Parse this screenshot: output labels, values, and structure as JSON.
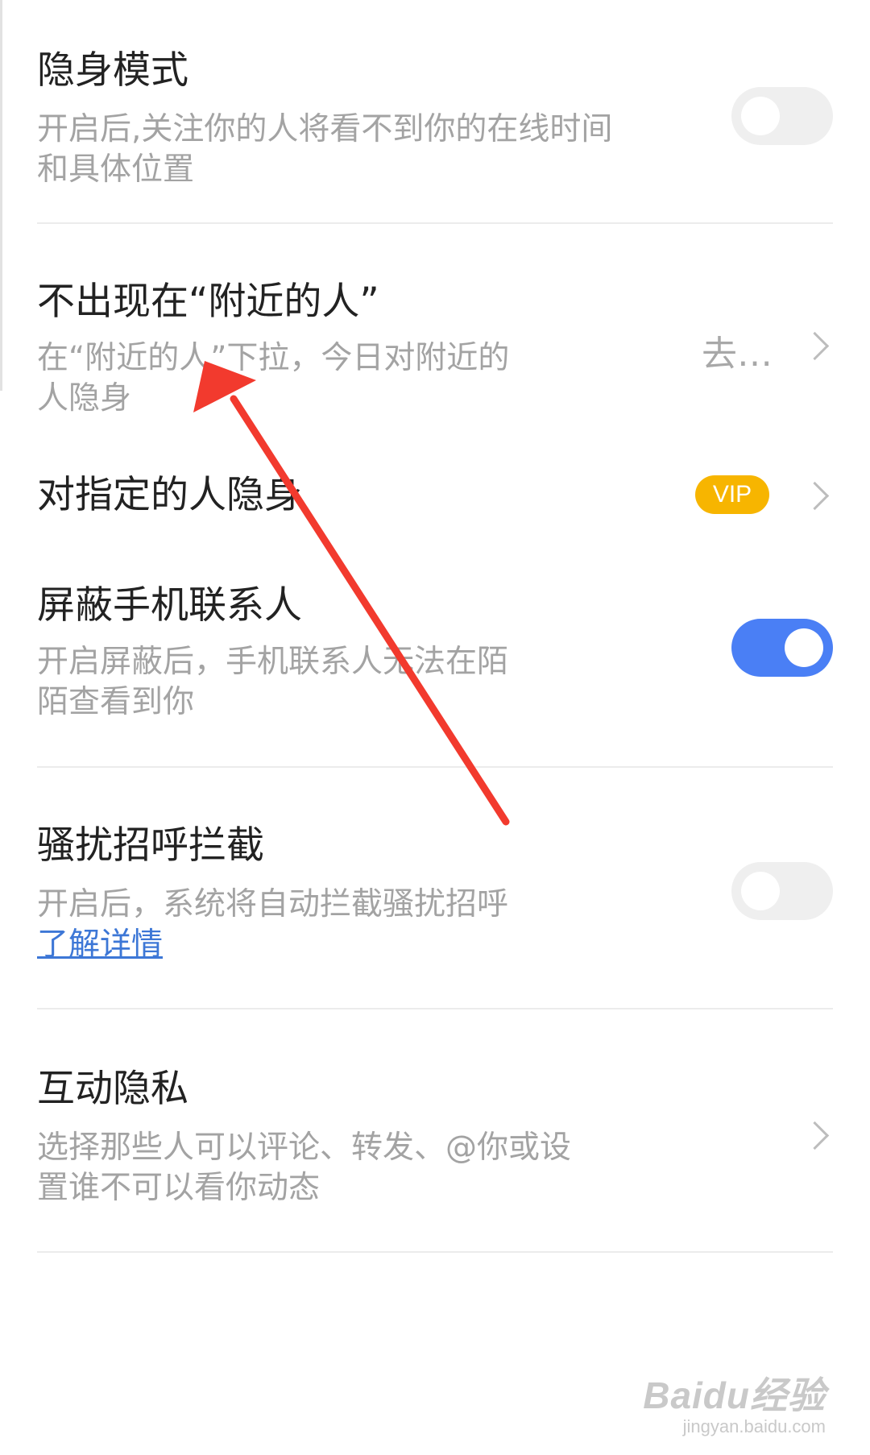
{
  "stealth_mode": {
    "title": "隐身模式",
    "description": "开启后,关注你的人将看不到你的在线时间和具体位置",
    "toggle_state": "off"
  },
  "nearby_people": {
    "title": "不出现在“附近的人”",
    "description": "在“附近的人”下拉，今日对附近的人隐身",
    "value": "去…"
  },
  "hide_from_specific": {
    "title": "对指定的人隐身",
    "badge": "VIP"
  },
  "block_contacts": {
    "title": "屏蔽手机联系人",
    "description": "开启屏蔽后，手机联系人无法在陌陌查看到你",
    "toggle_state": "on"
  },
  "harassment_block": {
    "title": "骚扰招呼拦截",
    "description": "开启后，系统将自动拦截骚扰招呼 ",
    "link": "了解详情",
    "toggle_state": "off"
  },
  "interaction_privacy": {
    "title": "互动隐私",
    "description": "选择那些人可以评论、转发、@你或设置谁不可以看你动态"
  },
  "watermark": {
    "brand": "Baidu经验",
    "url": "jingyan.baidu.com"
  },
  "colors": {
    "toggle_on": "#4a7ff5",
    "toggle_off": "#efefef",
    "vip_badge": "#f7b500",
    "link": "#3d77d6",
    "annotation_arrow": "#f23a2e"
  }
}
